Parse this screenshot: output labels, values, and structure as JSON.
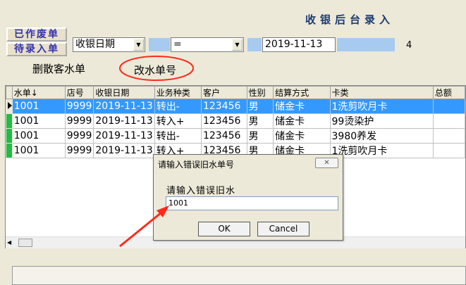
{
  "header": {
    "title": "收银后台录入"
  },
  "toolbar": {
    "void_button": "已作废单",
    "pending_button": "待录入单",
    "field_select": "收银日期",
    "operator_select": "=",
    "date_value": "2019-11-13",
    "count": "4",
    "delete_link": "删散客水单",
    "change_link": "改水单号"
  },
  "grid": {
    "columns": [
      "水单↓",
      "店号",
      "收银日期",
      "业务种类",
      "客户",
      "性别",
      "结算方式",
      "卡类",
      "总额"
    ],
    "rows": [
      [
        "1001",
        "9999",
        "2019-11-13",
        "转出-",
        "123456",
        "男",
        "储金卡",
        "1洗剪吹月卡",
        ""
      ],
      [
        "1001",
        "9999",
        "2019-11-13",
        "转入+",
        "123456",
        "男",
        "储金卡",
        "99烫染护",
        ""
      ],
      [
        "1001",
        "9999",
        "2019-11-13",
        "转出-",
        "123456",
        "男",
        "储金卡",
        "3980养发",
        ""
      ],
      [
        "1001",
        "9999",
        "2019-11-13",
        "转入+",
        "123456",
        "男",
        "储金卡",
        "1洗剪吹月卡",
        ""
      ]
    ]
  },
  "dialog": {
    "title": "请输入错误旧水单号",
    "prompt": "请输入错误旧水",
    "input_value": "1001",
    "ok": "OK",
    "cancel": "Cancel"
  },
  "colors": {
    "selection": "#3399ff",
    "indicator": "#22bb44",
    "annotation": "#ff2a1a",
    "title": "#1b3a70"
  },
  "icons": {
    "close": "close-icon",
    "row_pointer": "row-pointer-icon",
    "dropdown": "chevron-down-icon"
  }
}
